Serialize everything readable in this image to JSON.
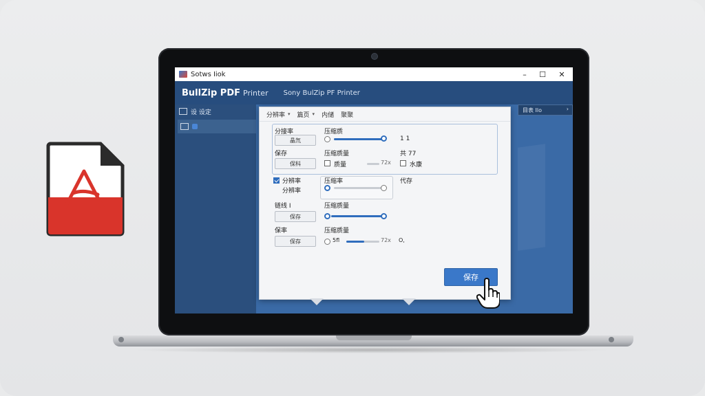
{
  "window": {
    "title": "Sotws Iiok",
    "controls": [
      "–",
      "☐",
      "✕"
    ]
  },
  "app": {
    "name": "BullZip PDF",
    "name_suffix": "Printer",
    "subtitle": "Sony BulZip PF Printer"
  },
  "sidebar": {
    "items": [
      {
        "label": "设 设定",
        "icon": "settings-icon"
      },
      {
        "label": "",
        "icon": "folder-icon"
      }
    ]
  },
  "right_chip": {
    "label": "目表 Ilo",
    "chevron": "›"
  },
  "dialog": {
    "tabs": [
      {
        "label": "分辨率"
      },
      {
        "label": "篇页"
      },
      {
        "label": "内储"
      },
      {
        "label": "聚聚"
      }
    ],
    "group1": {
      "resolution_label": "分接率",
      "resolution_button": "晶氘",
      "compression_label": "压缩质",
      "value_label": "1 1",
      "save_label": "保存",
      "save_button": "保科",
      "quality_label": "压缩质量",
      "quality_checkbox_label": "质量",
      "quality_value": "72x",
      "right_label_2": "共 77",
      "watermark_checkbox_label": "水康"
    },
    "section2": {
      "option_label": "分辨率",
      "option_sub": "分辨率",
      "sub_label": "压缩率",
      "right_label": "代存"
    },
    "section3": {
      "label": "链线 I",
      "button": "保存",
      "quality_label": "压缩质量"
    },
    "section4": {
      "label": "保率",
      "button": "保存",
      "quality_label": "压缩质量",
      "radio_label": "5fl",
      "value": "72x",
      "end_marker": "O,"
    },
    "save_button": "保存",
    "slider_values": {
      "compression": 1.0,
      "quality_top": 0.25,
      "sub": 0.0,
      "section3": 1.0,
      "section4": 0.55
    }
  },
  "colors": {
    "accent": "#3a78c9",
    "app_bar": "#274d7e",
    "pdf_red": "#d9342b"
  }
}
